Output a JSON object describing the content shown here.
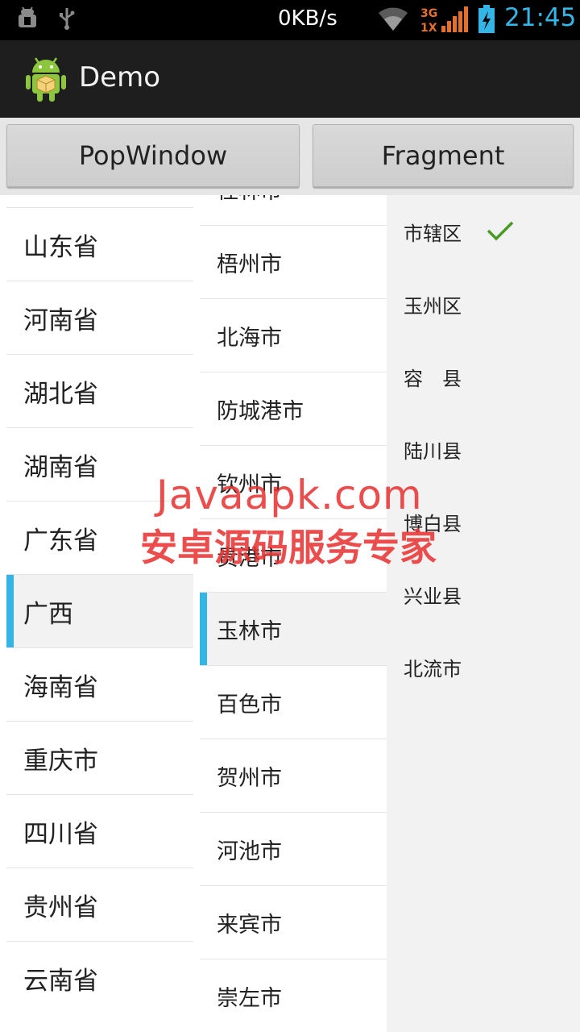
{
  "status_bar": {
    "speed": "0KB/s",
    "network": "3G 1X",
    "time": "21:45",
    "time_color": "#33b5e5"
  },
  "action_bar": {
    "title": "Demo",
    "icon": "android-app-icon"
  },
  "buttons": {
    "popwindow": "PopWindow",
    "fragment": "Fragment"
  },
  "provinces": {
    "items": [
      "山东省",
      "河南省",
      "湖北省",
      "湖南省",
      "广东省",
      "广西",
      "海南省",
      "重庆市",
      "四川省",
      "贵州省",
      "云南省"
    ],
    "selected": "广西"
  },
  "cities": {
    "items": [
      "桂林市",
      "梧州市",
      "北海市",
      "防城港市",
      "钦州市",
      "贵港市",
      "玉林市",
      "百色市",
      "贺州市",
      "河池市",
      "来宾市",
      "崇左市"
    ],
    "selected": "玉林市"
  },
  "districts": {
    "items": [
      "市辖区",
      "玉州区",
      "容　县",
      "陆川县",
      "博白县",
      "兴业县",
      "北流市"
    ],
    "checked": "市辖区"
  },
  "watermark": {
    "line1": "Javaapk.com",
    "line2": "安卓源码服务专家"
  },
  "colors": {
    "accent": "#33b5e5",
    "check": "#4a9a2a",
    "watermark": "#e83434"
  }
}
